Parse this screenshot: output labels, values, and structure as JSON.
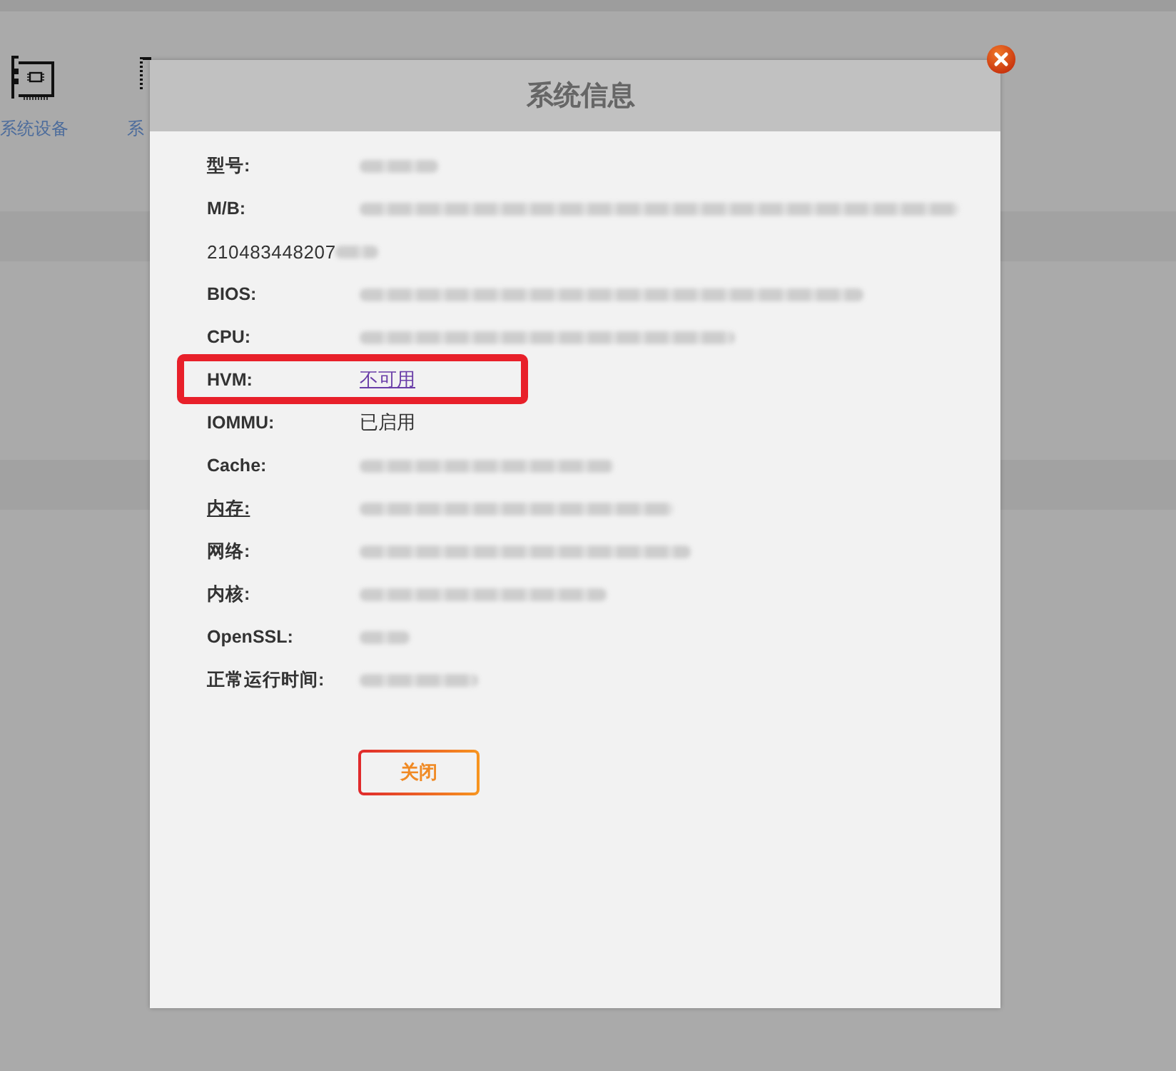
{
  "background": {
    "icons": [
      {
        "kind": "card",
        "label": "系统设备"
      },
      {
        "kind": "strip",
        "label": "系"
      }
    ]
  },
  "dialog": {
    "title": "系统信息",
    "rows": [
      {
        "label": "型号:",
        "kind": "redacted",
        "underlined": false,
        "highlighted": false
      },
      {
        "label": "M/B:",
        "kind": "redacted",
        "continuation": "210483448207",
        "underlined": false,
        "highlighted": false
      },
      {
        "label": "BIOS:",
        "kind": "redacted",
        "underlined": false,
        "highlighted": false
      },
      {
        "label": "CPU:",
        "kind": "redacted",
        "underlined": false,
        "highlighted": false
      },
      {
        "label": "HVM:",
        "kind": "link",
        "value": "不可用",
        "underlined": false,
        "highlighted": true
      },
      {
        "label": "IOMMU:",
        "kind": "text",
        "value": "已启用",
        "underlined": false,
        "highlighted": false
      },
      {
        "label": "Cache:",
        "kind": "redacted",
        "underlined": false,
        "highlighted": false
      },
      {
        "label": "内存:",
        "kind": "redacted",
        "underlined": true,
        "highlighted": false
      },
      {
        "label": "网络:",
        "kind": "redacted",
        "underlined": false,
        "highlighted": false
      },
      {
        "label": "内核:",
        "kind": "redacted",
        "underlined": false,
        "highlighted": false
      },
      {
        "label": "OpenSSL:",
        "kind": "redacted",
        "underlined": false,
        "highlighted": false
      },
      {
        "label": "正常运行时间:",
        "kind": "redacted",
        "underlined": false,
        "highlighted": false
      }
    ],
    "buttons": [
      {
        "label": "关闭"
      }
    ]
  }
}
